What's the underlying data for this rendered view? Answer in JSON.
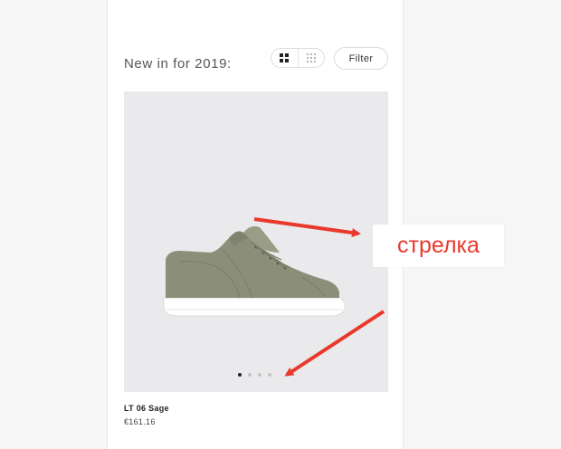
{
  "header": {
    "title": "New in for 2019:",
    "filter_label": "Filter",
    "view_options": [
      {
        "icon": "grid-large-icon",
        "active": true
      },
      {
        "icon": "grid-small-icon",
        "active": false
      }
    ]
  },
  "product": {
    "name": "LT 06 Sage",
    "price": "€161.16",
    "image_icon": "sneaker-image",
    "image_count": 4,
    "active_image": 1
  },
  "annotation": {
    "label": "стрелка",
    "color": "#e8392c"
  },
  "colors": {
    "image_background": "#eaeaec",
    "shoe_upper": "#8b8e78",
    "sole": "#ffffff"
  }
}
